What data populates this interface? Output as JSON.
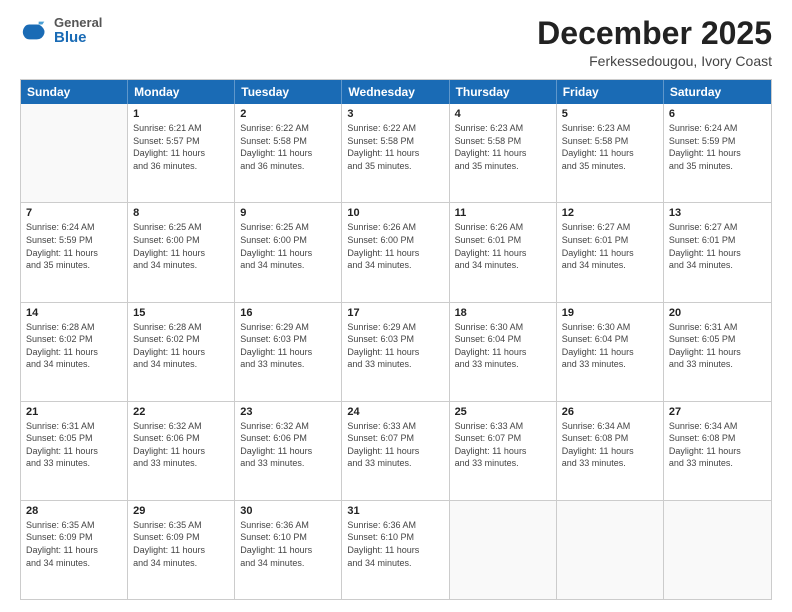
{
  "logo": {
    "general": "General",
    "blue": "Blue"
  },
  "header": {
    "month": "December 2025",
    "location": "Ferkessedougou, Ivory Coast"
  },
  "weekdays": [
    "Sunday",
    "Monday",
    "Tuesday",
    "Wednesday",
    "Thursday",
    "Friday",
    "Saturday"
  ],
  "rows": [
    [
      {
        "day": "",
        "info": ""
      },
      {
        "day": "1",
        "info": "Sunrise: 6:21 AM\nSunset: 5:57 PM\nDaylight: 11 hours\nand 36 minutes."
      },
      {
        "day": "2",
        "info": "Sunrise: 6:22 AM\nSunset: 5:58 PM\nDaylight: 11 hours\nand 36 minutes."
      },
      {
        "day": "3",
        "info": "Sunrise: 6:22 AM\nSunset: 5:58 PM\nDaylight: 11 hours\nand 35 minutes."
      },
      {
        "day": "4",
        "info": "Sunrise: 6:23 AM\nSunset: 5:58 PM\nDaylight: 11 hours\nand 35 minutes."
      },
      {
        "day": "5",
        "info": "Sunrise: 6:23 AM\nSunset: 5:58 PM\nDaylight: 11 hours\nand 35 minutes."
      },
      {
        "day": "6",
        "info": "Sunrise: 6:24 AM\nSunset: 5:59 PM\nDaylight: 11 hours\nand 35 minutes."
      }
    ],
    [
      {
        "day": "7",
        "info": "Sunrise: 6:24 AM\nSunset: 5:59 PM\nDaylight: 11 hours\nand 35 minutes."
      },
      {
        "day": "8",
        "info": "Sunrise: 6:25 AM\nSunset: 6:00 PM\nDaylight: 11 hours\nand 34 minutes."
      },
      {
        "day": "9",
        "info": "Sunrise: 6:25 AM\nSunset: 6:00 PM\nDaylight: 11 hours\nand 34 minutes."
      },
      {
        "day": "10",
        "info": "Sunrise: 6:26 AM\nSunset: 6:00 PM\nDaylight: 11 hours\nand 34 minutes."
      },
      {
        "day": "11",
        "info": "Sunrise: 6:26 AM\nSunset: 6:01 PM\nDaylight: 11 hours\nand 34 minutes."
      },
      {
        "day": "12",
        "info": "Sunrise: 6:27 AM\nSunset: 6:01 PM\nDaylight: 11 hours\nand 34 minutes."
      },
      {
        "day": "13",
        "info": "Sunrise: 6:27 AM\nSunset: 6:01 PM\nDaylight: 11 hours\nand 34 minutes."
      }
    ],
    [
      {
        "day": "14",
        "info": "Sunrise: 6:28 AM\nSunset: 6:02 PM\nDaylight: 11 hours\nand 34 minutes."
      },
      {
        "day": "15",
        "info": "Sunrise: 6:28 AM\nSunset: 6:02 PM\nDaylight: 11 hours\nand 34 minutes."
      },
      {
        "day": "16",
        "info": "Sunrise: 6:29 AM\nSunset: 6:03 PM\nDaylight: 11 hours\nand 33 minutes."
      },
      {
        "day": "17",
        "info": "Sunrise: 6:29 AM\nSunset: 6:03 PM\nDaylight: 11 hours\nand 33 minutes."
      },
      {
        "day": "18",
        "info": "Sunrise: 6:30 AM\nSunset: 6:04 PM\nDaylight: 11 hours\nand 33 minutes."
      },
      {
        "day": "19",
        "info": "Sunrise: 6:30 AM\nSunset: 6:04 PM\nDaylight: 11 hours\nand 33 minutes."
      },
      {
        "day": "20",
        "info": "Sunrise: 6:31 AM\nSunset: 6:05 PM\nDaylight: 11 hours\nand 33 minutes."
      }
    ],
    [
      {
        "day": "21",
        "info": "Sunrise: 6:31 AM\nSunset: 6:05 PM\nDaylight: 11 hours\nand 33 minutes."
      },
      {
        "day": "22",
        "info": "Sunrise: 6:32 AM\nSunset: 6:06 PM\nDaylight: 11 hours\nand 33 minutes."
      },
      {
        "day": "23",
        "info": "Sunrise: 6:32 AM\nSunset: 6:06 PM\nDaylight: 11 hours\nand 33 minutes."
      },
      {
        "day": "24",
        "info": "Sunrise: 6:33 AM\nSunset: 6:07 PM\nDaylight: 11 hours\nand 33 minutes."
      },
      {
        "day": "25",
        "info": "Sunrise: 6:33 AM\nSunset: 6:07 PM\nDaylight: 11 hours\nand 33 minutes."
      },
      {
        "day": "26",
        "info": "Sunrise: 6:34 AM\nSunset: 6:08 PM\nDaylight: 11 hours\nand 33 minutes."
      },
      {
        "day": "27",
        "info": "Sunrise: 6:34 AM\nSunset: 6:08 PM\nDaylight: 11 hours\nand 33 minutes."
      }
    ],
    [
      {
        "day": "28",
        "info": "Sunrise: 6:35 AM\nSunset: 6:09 PM\nDaylight: 11 hours\nand 34 minutes."
      },
      {
        "day": "29",
        "info": "Sunrise: 6:35 AM\nSunset: 6:09 PM\nDaylight: 11 hours\nand 34 minutes."
      },
      {
        "day": "30",
        "info": "Sunrise: 6:36 AM\nSunset: 6:10 PM\nDaylight: 11 hours\nand 34 minutes."
      },
      {
        "day": "31",
        "info": "Sunrise: 6:36 AM\nSunset: 6:10 PM\nDaylight: 11 hours\nand 34 minutes."
      },
      {
        "day": "",
        "info": ""
      },
      {
        "day": "",
        "info": ""
      },
      {
        "day": "",
        "info": ""
      }
    ]
  ]
}
